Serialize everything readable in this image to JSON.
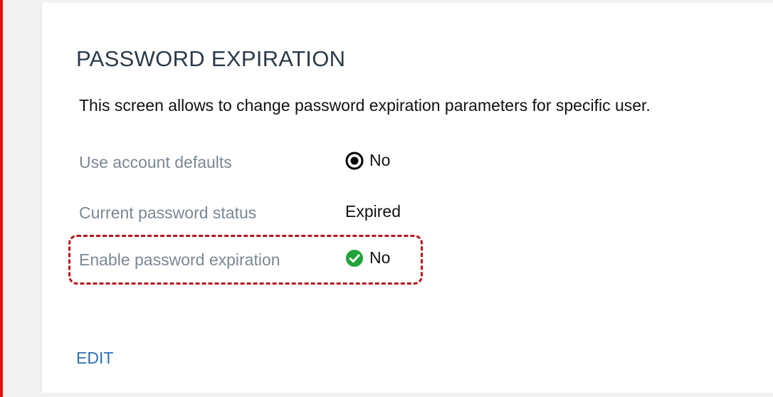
{
  "section": {
    "title": "PASSWORD EXPIRATION",
    "description": "This screen allows to change password expiration parameters for specific user."
  },
  "rows": [
    {
      "label": "Use account defaults",
      "value": "No",
      "icon": "radio-selected-icon"
    },
    {
      "label": "Current password status",
      "value": "Expired",
      "icon": ""
    },
    {
      "label": "Enable password expiration",
      "value": "No",
      "icon": "green-check-circle-icon"
    }
  ],
  "actions": {
    "edit_label": "EDIT"
  },
  "colors": {
    "accent_red": "#e8100f",
    "highlight_dashed": "#b5161c",
    "check_green": "#22a33a",
    "link_blue": "#2f6fb3",
    "label_gray": "#7b8794"
  }
}
